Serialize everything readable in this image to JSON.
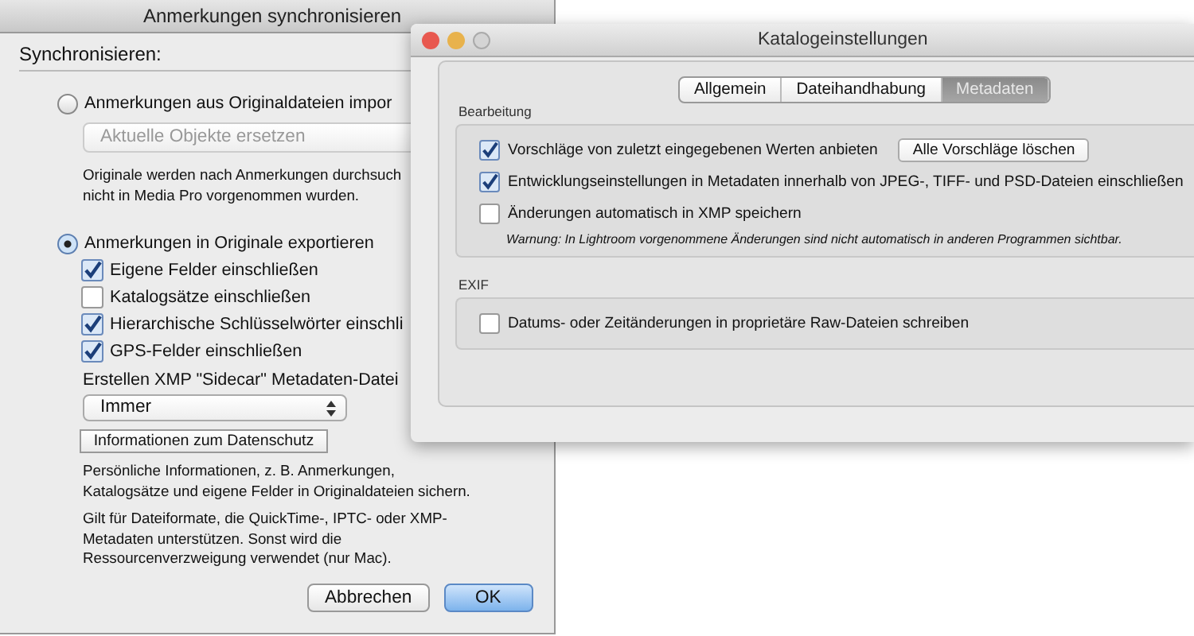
{
  "back_window": {
    "title": "Anmerkungen synchronisieren",
    "section_label": "Synchronisieren:",
    "import_option": {
      "label": "Anmerkungen aus Originaldateien impor",
      "selected": false
    },
    "import_dropdown": {
      "value": "Aktuelle Objekte ersetzen",
      "disabled": true
    },
    "import_note": [
      "Originale werden nach Anmerkungen durchsuch",
      "nicht in Media Pro vorgenommen wurden."
    ],
    "export_option": {
      "label": "Anmerkungen in Originale exportieren",
      "selected": true
    },
    "checkboxes": [
      {
        "label": "Eigene Felder einschließen",
        "checked": true
      },
      {
        "label": "Katalogsätze einschließen",
        "checked": false
      },
      {
        "label": "Hierarchische Schlüsselwörter einschli",
        "checked": true
      },
      {
        "label": "GPS-Felder einschließen",
        "checked": true
      }
    ],
    "sidecar_label": "Erstellen XMP \"Sidecar\" Metadaten-Datei",
    "sidecar_dropdown": {
      "value": "Immer"
    },
    "privacy_button": "Informationen zum Datenschutz",
    "privacy_note": [
      "Persönliche Informationen, z. B. Anmerkungen,",
      "Katalogsätze und eigene Felder in Originaldateien sichern."
    ],
    "formats_note": [
      "Gilt für Dateiformate, die QuickTime-, IPTC- oder XMP-",
      "Metadaten unterstützen. Sonst wird die",
      "Ressourcenverzweigung verwendet (nur Mac)."
    ],
    "buttons": [
      {
        "label": "Abbrechen",
        "default": false
      },
      {
        "label": "OK",
        "default": true
      }
    ]
  },
  "front_window": {
    "title": "Katalogeinstellungen",
    "tabs": [
      {
        "label": "Allgemein",
        "selected": false
      },
      {
        "label": "Dateihandhabung",
        "selected": false
      },
      {
        "label": "Metadaten",
        "selected": true
      }
    ],
    "groups": [
      {
        "title": "Bearbeitung",
        "items": [
          {
            "kind": "checkbox",
            "label": "Vorschläge von zuletzt eingegebenen Werten anbieten",
            "checked": true,
            "button": "Alle Vorschläge löschen"
          },
          {
            "kind": "checkbox",
            "label": "Entwicklungseinstellungen in Metadaten innerhalb von JPEG-, TIFF- und PSD-Dateien einschließen",
            "checked": true
          },
          {
            "kind": "checkbox",
            "label": "Änderungen automatisch in XMP speichern",
            "checked": false
          },
          {
            "kind": "note",
            "text": "Warnung: In Lightroom vorgenommene Änderungen sind nicht automatisch in anderen Programmen sichtbar."
          }
        ]
      },
      {
        "title": "EXIF",
        "items": [
          {
            "kind": "checkbox",
            "label": "Datums- oder Zeitänderungen in proprietäre Raw-Dateien schreiben",
            "checked": false
          }
        ]
      }
    ]
  }
}
